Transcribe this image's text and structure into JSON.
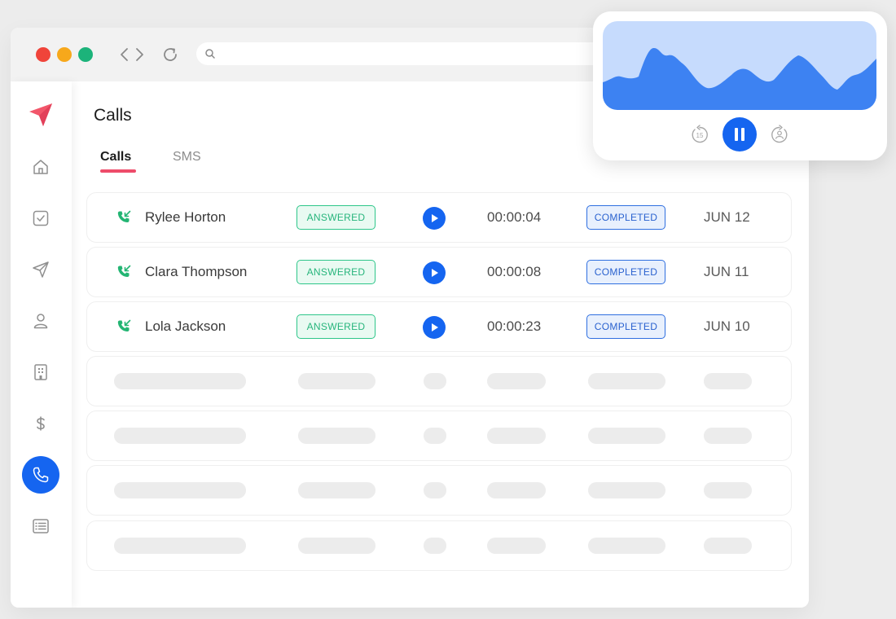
{
  "window": {
    "controls": [
      "close",
      "minimize",
      "maximize"
    ]
  },
  "sidebar": {
    "items": [
      {
        "name": "logo",
        "icon": "paper-plane-icon"
      },
      {
        "name": "home",
        "icon": "home-icon"
      },
      {
        "name": "tasks",
        "icon": "checkbox-icon"
      },
      {
        "name": "send",
        "icon": "send-icon"
      },
      {
        "name": "contacts",
        "icon": "user-icon"
      },
      {
        "name": "companies",
        "icon": "building-icon"
      },
      {
        "name": "billing",
        "icon": "dollar-icon"
      },
      {
        "name": "calls",
        "icon": "phone-icon",
        "active": true
      },
      {
        "name": "list",
        "icon": "list-icon"
      }
    ]
  },
  "main": {
    "title": "Calls",
    "tabs": [
      {
        "label": "Calls",
        "active": true
      },
      {
        "label": "SMS",
        "active": false
      }
    ]
  },
  "calls": [
    {
      "name": "Rylee Horton",
      "status": "ANSWERED",
      "duration": "00:00:04",
      "state": "COMPLETED",
      "date": "JUN 12"
    },
    {
      "name": "Clara Thompson",
      "status": "ANSWERED",
      "duration": "00:00:08",
      "state": "COMPLETED",
      "date": "JUN 11"
    },
    {
      "name": "Lola Jackson",
      "status": "ANSWERED",
      "duration": "00:00:23",
      "state": "COMPLETED",
      "date": "JUN 10"
    }
  ],
  "player": {
    "rewind_label": "15",
    "state": "playing"
  },
  "colors": {
    "accent": "#1565f0",
    "answered": "#27b57c",
    "completed": "#2a62cf",
    "tab_underline": "#ee4c6a",
    "logo": "#f2566a"
  }
}
